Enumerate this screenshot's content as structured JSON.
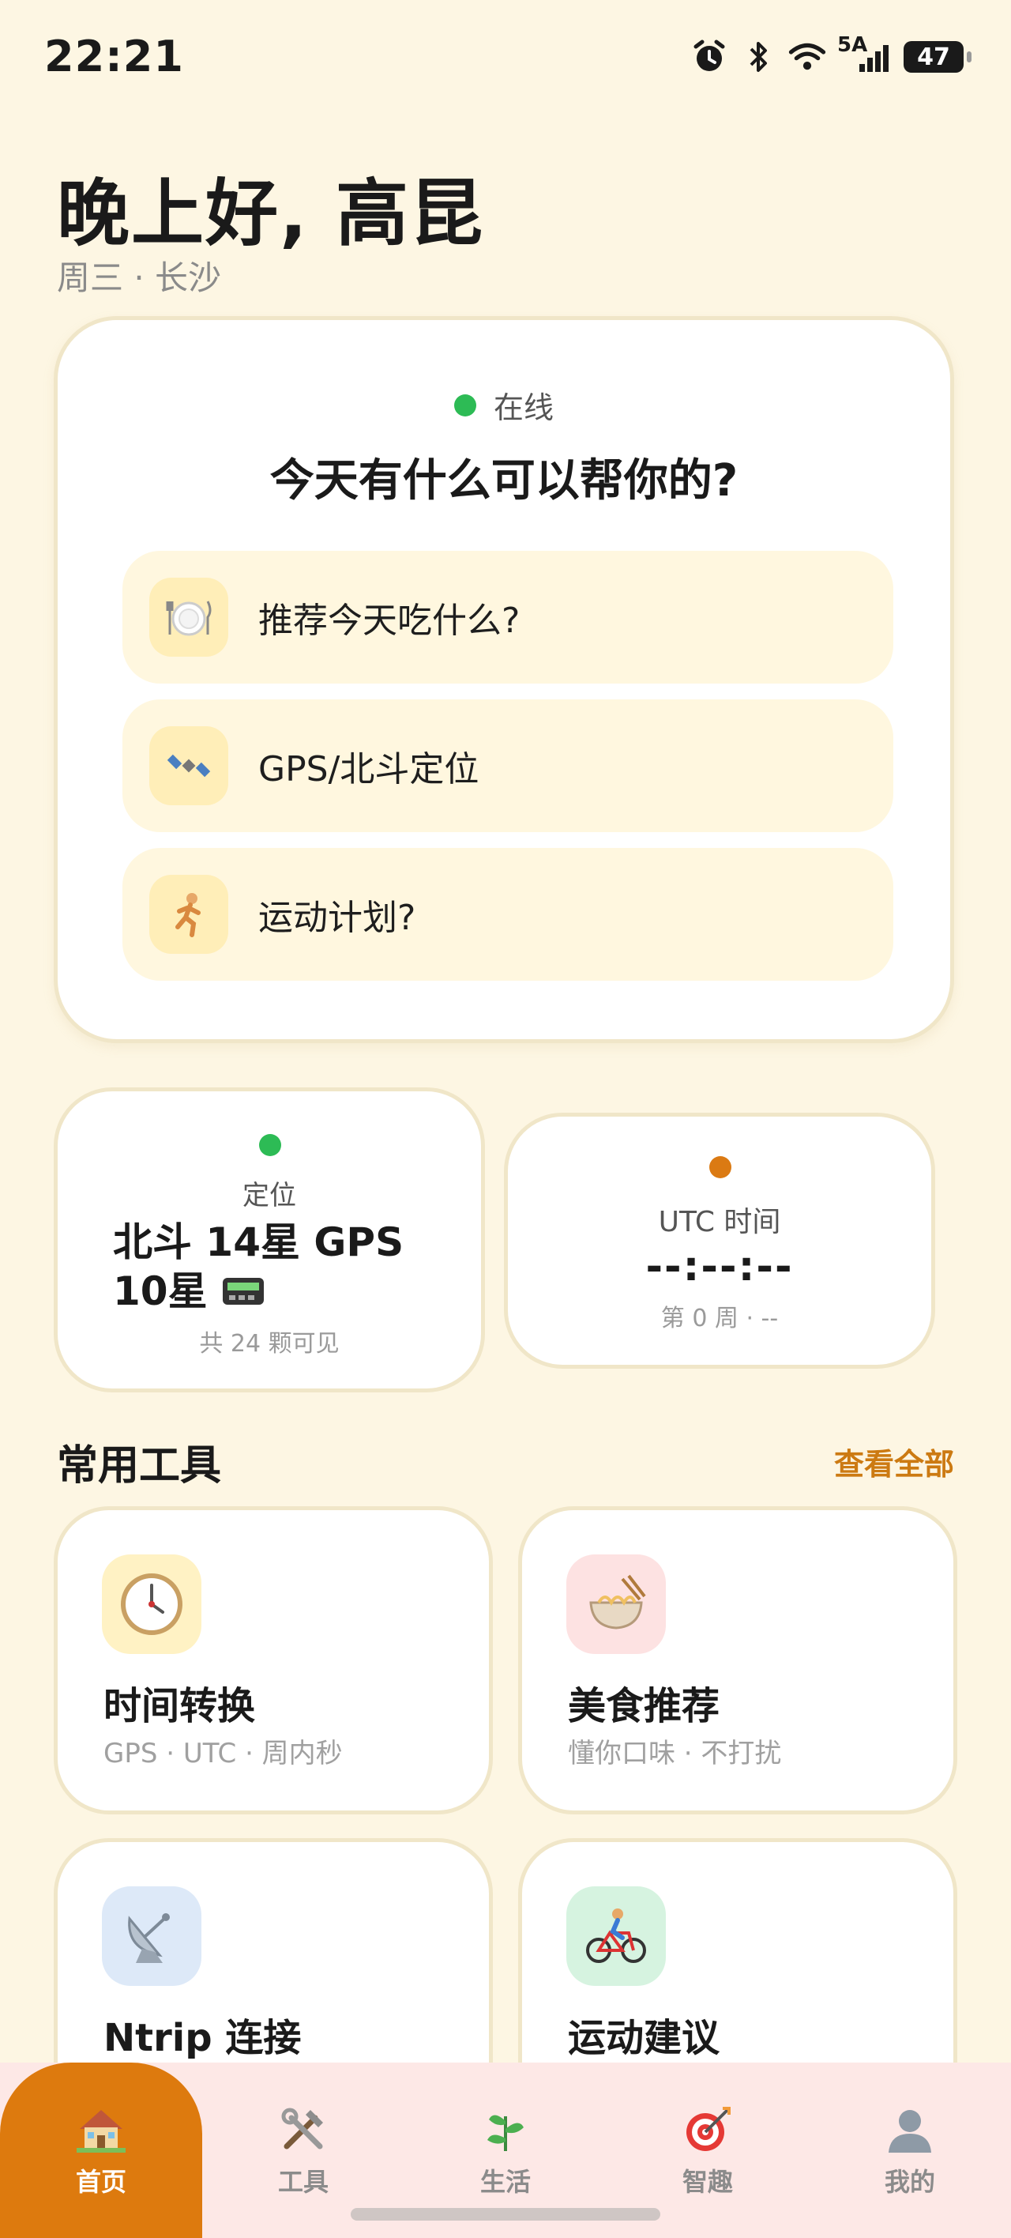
{
  "status_bar": {
    "time": "22:21",
    "signal_label": "5A",
    "battery": "47"
  },
  "header": {
    "greeting": "晚上好, 高昆",
    "subline": "周三 · 长沙"
  },
  "assistant": {
    "status": "在线",
    "title": "今天有什么可以帮你的?",
    "suggestions": [
      {
        "icon": "plate-icon",
        "label": "推荐今天吃什么?"
      },
      {
        "icon": "satellite-icon",
        "label": "GPS/北斗定位"
      },
      {
        "icon": "runner-icon",
        "label": "运动计划?"
      }
    ]
  },
  "location_card": {
    "title": "定位",
    "value": "北斗 14星 GPS 10星",
    "footer": "共 24 颗可见"
  },
  "utc_card": {
    "title": "UTC 时间",
    "value": "--:--:--",
    "footer": "第 0 周 · --"
  },
  "tools_section": {
    "title": "常用工具",
    "view_all": "查看全部",
    "tools": [
      {
        "name": "时间转换",
        "sub": "GPS · UTC · 周内秒",
        "icon": "clock-icon",
        "bg": "#fff2c4"
      },
      {
        "name": "美食推荐",
        "sub": "懂你口味 · 不打扰",
        "icon": "noodle-bowl-icon",
        "bg": "#fde2e2"
      },
      {
        "name": "Ntrip 连接",
        "sub": "",
        "icon": "satellite-dish-icon",
        "bg": "#dde9f8"
      },
      {
        "name": "运动建议",
        "sub": "",
        "icon": "cyclist-icon",
        "bg": "#d6f3e0"
      }
    ]
  },
  "bottom_nav": {
    "items": [
      {
        "label": "首页",
        "icon": "house-icon",
        "active": true
      },
      {
        "label": "工具",
        "icon": "tools-icon",
        "active": false
      },
      {
        "label": "生活",
        "icon": "herb-icon",
        "active": false
      },
      {
        "label": "智趣",
        "icon": "target-icon",
        "active": false
      },
      {
        "label": "我的",
        "icon": "person-icon",
        "active": false
      }
    ]
  },
  "colors": {
    "accent": "#dd7a0e",
    "online": "#2dbb55",
    "background": "#fdf6e3"
  }
}
